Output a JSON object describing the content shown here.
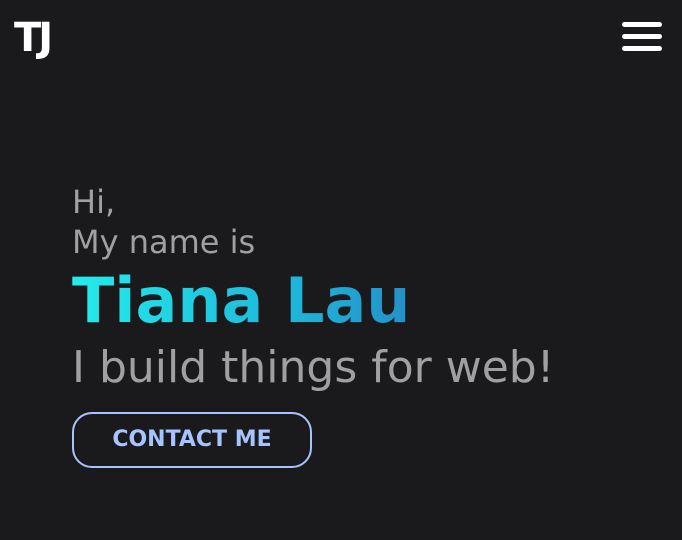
{
  "header": {
    "logo_text": "TJ",
    "menu_icon": "hamburger-menu-icon"
  },
  "hero": {
    "greeting_line1": "Hi,",
    "greeting_line2": "My name is",
    "name": "Tiana Lau",
    "tagline": "I build things for web!",
    "contact_label": "CONTACT ME"
  },
  "colors": {
    "background": "#1a1a1c",
    "text_muted": "#a0a0a0",
    "name_gradient_start": "#22ecec",
    "name_gradient_end": "#2a63b3",
    "button_accent": "#a6c4ff"
  }
}
